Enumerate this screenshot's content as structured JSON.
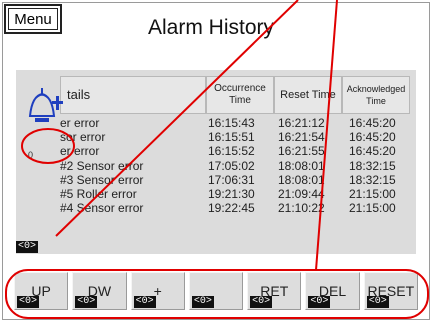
{
  "menu": {
    "label": "Menu"
  },
  "screen": {
    "title": "Alarm History"
  },
  "table": {
    "headers": {
      "details": "tails",
      "occurrence": "Occurrence Time",
      "reset": "Reset Time",
      "acknowledged": "Acknowledged Time"
    },
    "rows": [
      {
        "details": "er error",
        "occurrence": "16:15:43",
        "reset": "16:21:12",
        "acknowledged": "16:45:20"
      },
      {
        "details": "sor error",
        "occurrence": "16:15:51",
        "reset": "16:21:54",
        "acknowledged": "16:45:20"
      },
      {
        "details": "er error",
        "occurrence": "16:15:52",
        "reset": "16:21:55",
        "acknowledged": "16:45:20"
      },
      {
        "details": "#2 Sensor error",
        "occurrence": "17:05:02",
        "reset": "18:08:01",
        "acknowledged": "18:32:15"
      },
      {
        "details": "#3 Sensor error",
        "occurrence": "17:06:31",
        "reset": "18:08:01",
        "acknowledged": "18:32:15"
      },
      {
        "details": "#5 Roller error",
        "occurrence": "19:21:30",
        "reset": "21:09:44",
        "acknowledged": "21:15:00"
      },
      {
        "details": "#4 Sensor error",
        "occurrence": "19:22:45",
        "reset": "21:10:22",
        "acknowledged": "21:15:00"
      }
    ]
  },
  "icon_tag": "0",
  "left_badge": "<0>",
  "buttons": [
    {
      "label": "UP",
      "badge": "<0>"
    },
    {
      "label": "DW",
      "badge": "<0>"
    },
    {
      "label": "+",
      "badge": "<0>"
    },
    {
      "label": "",
      "badge": "<0>"
    },
    {
      "label": "RET",
      "badge": "<0>"
    },
    {
      "label": "DEL",
      "badge": "<0>"
    },
    {
      "label": "RESET",
      "badge": "<0>"
    }
  ],
  "colors": {
    "annotation": "#e00000",
    "panel": "#dcdcdc",
    "badge": "#111111"
  }
}
